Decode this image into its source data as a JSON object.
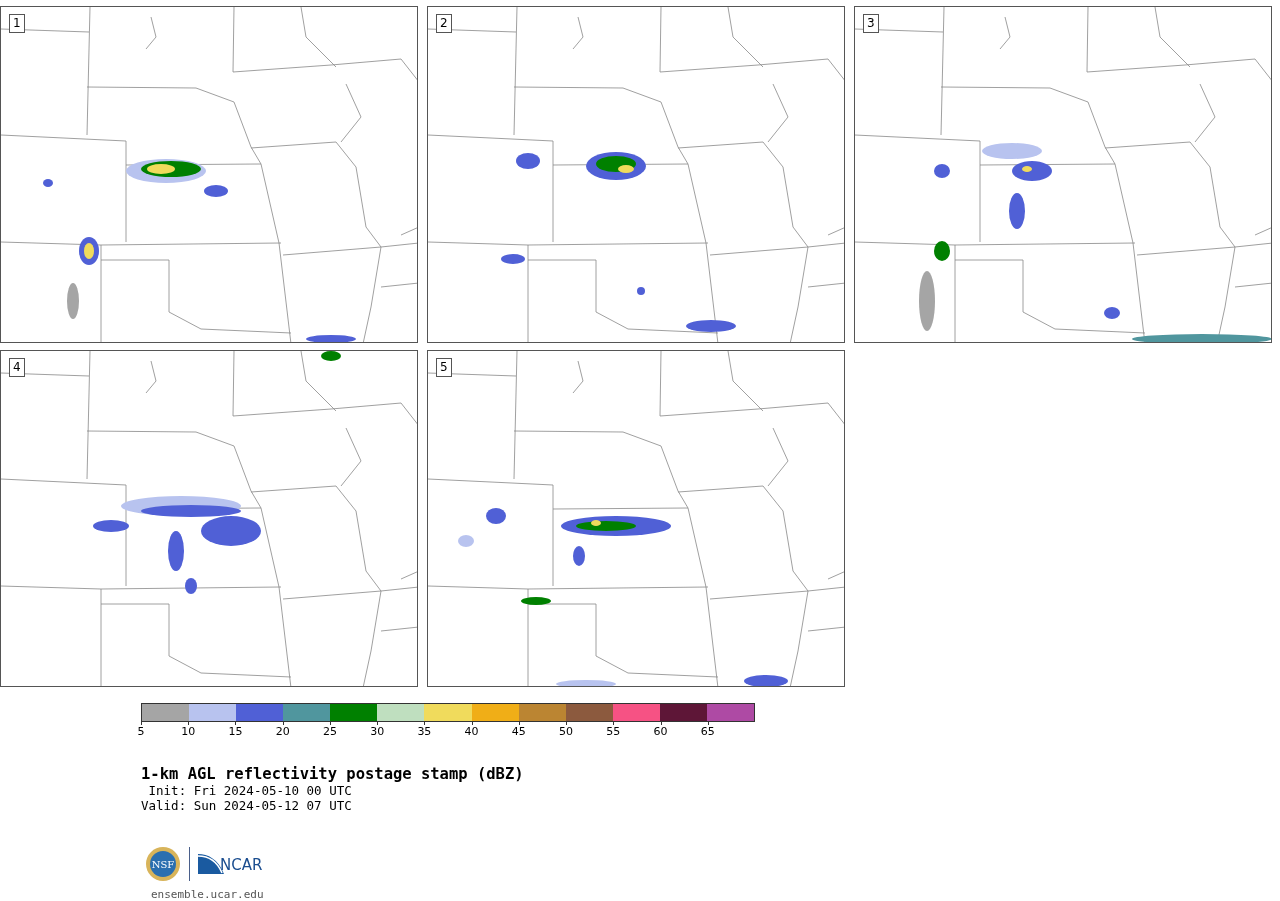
{
  "panels": [
    {
      "label": "1"
    },
    {
      "label": "2"
    },
    {
      "label": "3"
    },
    {
      "label": "4"
    },
    {
      "label": "5"
    }
  ],
  "colorbar": {
    "segments": [
      {
        "color": "#a5a5a5"
      },
      {
        "color": "#b8c3ef"
      },
      {
        "color": "#5060d6"
      },
      {
        "color": "#50969e"
      },
      {
        "color": "#008000"
      },
      {
        "color": "#bfdfbf"
      },
      {
        "color": "#f0db5c"
      },
      {
        "color": "#f0ae17"
      },
      {
        "color": "#bb8532"
      },
      {
        "color": "#8c5a3e"
      },
      {
        "color": "#f65284"
      },
      {
        "color": "#5e1637"
      },
      {
        "color": "#ae4aa4"
      }
    ],
    "ticks": [
      "5",
      "10",
      "15",
      "20",
      "25",
      "30",
      "35",
      "40",
      "45",
      "50",
      "55",
      "60",
      "65"
    ]
  },
  "title": "1-km AGL reflectivity postage stamp (dBZ)",
  "init": " Init: Fri 2024-05-10 00 UTC",
  "valid": "Valid: Sun 2024-05-12 07 UTC",
  "logos": {
    "nsf": "NSF",
    "ncar": "NCAR"
  },
  "site": "ensemble.ucar.edu"
}
